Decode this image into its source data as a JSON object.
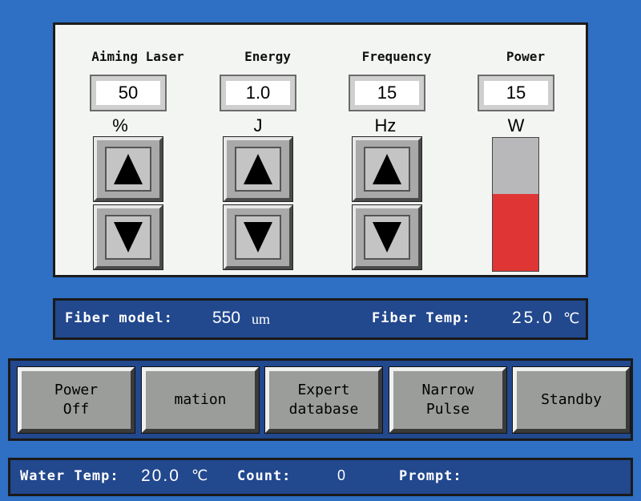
{
  "controls": [
    {
      "title": "Aiming Laser",
      "value": "50",
      "unit": "%"
    },
    {
      "title": "Energy",
      "value": "1.0",
      "unit": "J"
    },
    {
      "title": "Frequency",
      "value": "15",
      "unit": "Hz"
    },
    {
      "title": "Power",
      "value": "15",
      "unit": "W"
    }
  ],
  "power_level_fraction": 0.58,
  "colors": {
    "background": "#2f6fc4",
    "panel": "#f3f5f3",
    "bar_fill": "#e03535",
    "info_bar": "#22488e"
  },
  "icons": {
    "up": "up-arrow-icon",
    "down": "down-arrow-icon"
  },
  "fiber": {
    "model_label": "Fiber model:",
    "model_value": "550",
    "model_unit": "um",
    "temp_label": "Fiber Temp:",
    "temp_value": "25.0",
    "temp_unit": "℃"
  },
  "buttons": [
    {
      "label": "Power\nOff"
    },
    {
      "label": "mation"
    },
    {
      "label": "Expert\ndatabase"
    },
    {
      "label": "Narrow\nPulse"
    },
    {
      "label": "Standby"
    }
  ],
  "status": {
    "water_label": "Water Temp:",
    "water_value": "20.0",
    "water_unit": "℃",
    "count_label": "Count:",
    "count_value": "0",
    "prompt_label": "Prompt:",
    "prompt_value": ""
  }
}
